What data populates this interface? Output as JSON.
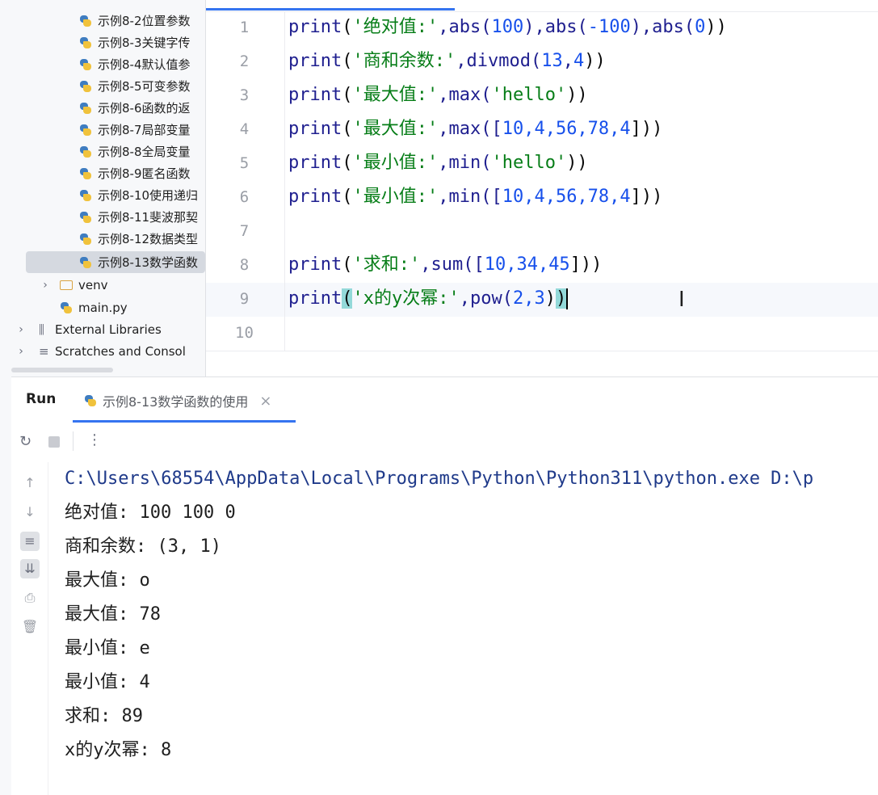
{
  "project_tree": {
    "items": [
      {
        "label": "示例8-2位置参数"
      },
      {
        "label": "示例8-3关键字传"
      },
      {
        "label": "示例8-4默认值参"
      },
      {
        "label": "示例8-5可变参数"
      },
      {
        "label": "示例8-6函数的返"
      },
      {
        "label": "示例8-7局部变量"
      },
      {
        "label": "示例8-8全局变量"
      },
      {
        "label": "示例8-9匿名函数"
      },
      {
        "label": "示例8-10使用递归"
      },
      {
        "label": "示例8-11斐波那契"
      },
      {
        "label": "示例8-12数据类型"
      },
      {
        "label": "示例8-13数学函数"
      }
    ],
    "venv": "venv",
    "main": "main.py",
    "external_libraries": "External Libraries",
    "scratches": "Scratches and Consol"
  },
  "editor": {
    "line_numbers": [
      "1",
      "2",
      "3",
      "4",
      "5",
      "6",
      "7",
      "8",
      "9",
      "10"
    ],
    "lines": [
      {
        "fn": "print",
        "open": "(",
        "str": "'绝对值:'",
        "rest": ",abs(",
        "n1": "100",
        "mid": "),abs(",
        "n2": "-100",
        "mid2": "),abs(",
        "n3": "0",
        "end": "))"
      },
      {
        "fn": "print",
        "open": "(",
        "str": "'商和余数:'",
        "rest": ",divmod(",
        "n1": "13",
        "mid": ",",
        "n2": "4",
        "end": "))"
      },
      {
        "fn": "print",
        "open": "(",
        "str": "'最大值:'",
        "rest": ",max(",
        "arg": "'hello'",
        "end": "))"
      },
      {
        "fn": "print",
        "open": "(",
        "str": "'最大值:'",
        "rest": ",max([",
        "list": "10,4,56,78,4",
        "end": "]))"
      },
      {
        "fn": "print",
        "open": "(",
        "str": "'最小值:'",
        "rest": ",min(",
        "arg": "'hello'",
        "end": "))"
      },
      {
        "fn": "print",
        "open": "(",
        "str": "'最小值:'",
        "rest": ",min([",
        "list": "10,4,56,78,4",
        "end": "]))"
      },
      {
        "fn": "print",
        "open": "(",
        "str": "'求和:'",
        "rest": ",sum([",
        "list": "10,34,45",
        "end": "]))"
      },
      {
        "fn": "print",
        "open": "(",
        "str": "'x的y次幂:'",
        "rest": ",pow(",
        "list": "2,3",
        "end": ")",
        ")": ")"
      }
    ]
  },
  "run_panel": {
    "label": "Run",
    "tab": "示例8-13数学函数的使用",
    "tab_close": "×",
    "output": [
      "C:\\Users\\68554\\AppData\\Local\\Programs\\Python\\Python311\\python.exe D:\\p",
      "绝对值: 100 100 0",
      "商和余数: (3, 1)",
      "最大值: o",
      "最大值: 78",
      "最小值: e",
      "最小值: 4",
      "求和: 89",
      "x的y次幂: 8"
    ]
  },
  "icons": {
    "rerun": "rerun-icon",
    "stop": "stop-icon",
    "more": "more-icon"
  }
}
